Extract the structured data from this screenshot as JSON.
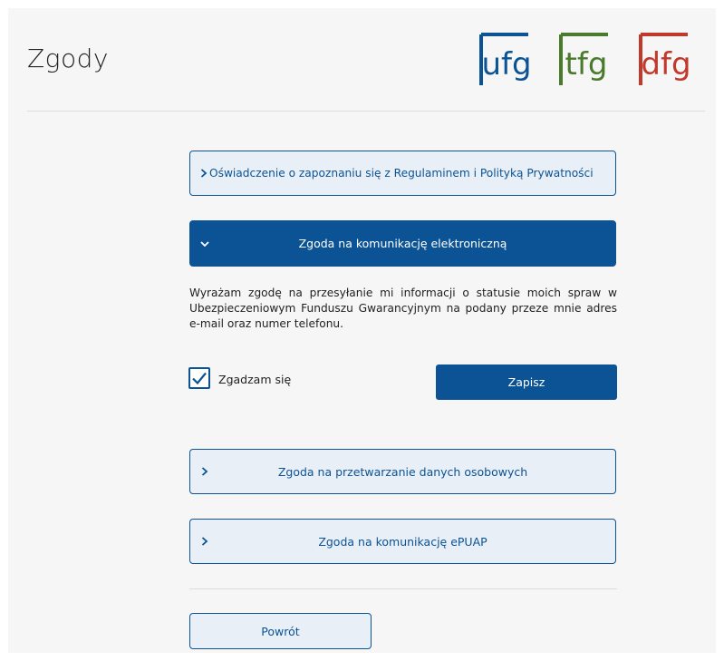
{
  "page": {
    "title": "Zgody"
  },
  "logos": [
    {
      "text": "ufg",
      "color": "#0b5394"
    },
    {
      "text": "tfg",
      "color": "#4a7a2c"
    },
    {
      "text": "dfg",
      "color": "#c0392b"
    }
  ],
  "accordions": {
    "regulations": {
      "label": "Oświadczenie o zapoznaniu się z Regulaminem i Polityką Prywatności",
      "expanded": false
    },
    "electronic": {
      "label": "Zgoda na komunikację elektroniczną",
      "expanded": true
    },
    "personal_data": {
      "label": "Zgoda na przetwarzanie danych osobowych",
      "expanded": false
    },
    "epuap": {
      "label": "Zgoda na komunikację ePUAP",
      "expanded": false
    }
  },
  "electronic_consent": {
    "text": "Wyrażam zgodę na przesyłanie mi informacji o statusie moich spraw w Ubezpieczeniowym Funduszu Gwarancyjnym na podany przeze mnie adres e-mail oraz numer telefonu.",
    "checkbox_label": "Zgadzam się",
    "checked": true,
    "save_label": "Zapisz"
  },
  "footer": {
    "back_label": "Powrót"
  },
  "colors": {
    "primary": "#0b5394",
    "panel_bg": "#f6f6f6",
    "button_light_bg": "#e9eff6"
  }
}
